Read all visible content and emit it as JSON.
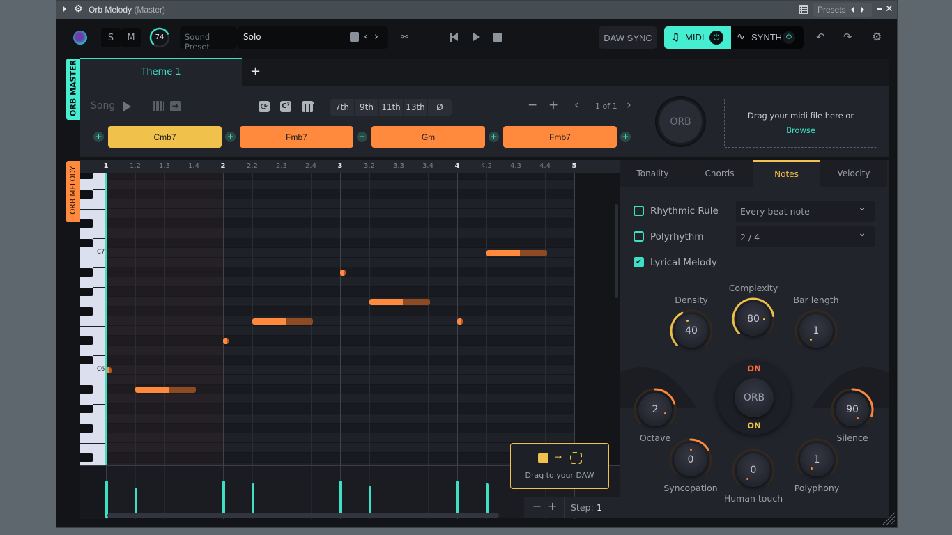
{
  "titlebar": {
    "app_name": "Orb Melody",
    "mode": "(Master)",
    "presets_label": "Presets"
  },
  "topbar": {
    "solo_label": "S",
    "mute_label": "M",
    "volume_value": "74",
    "volume_fraction": 0.74,
    "sound_preset_label": "Sound Preset",
    "sound_preset_value": "Solo",
    "daw_sync_label": "DAW SYNC",
    "midi_label": "MIDI",
    "synth_label": "SYNTH"
  },
  "side_tabs": {
    "master": "ORB MASTER",
    "melody": "ORB MELODY"
  },
  "theme_tabs": [
    {
      "label": "Theme 1",
      "active": true
    }
  ],
  "add_theme_label": "+",
  "song_controls": {
    "song_label": "Song",
    "extensions": [
      "7th",
      "9th",
      "11th",
      "13th",
      "Ø"
    ],
    "page_indicator": "1 of 1"
  },
  "chords": [
    {
      "label": "Cmb7",
      "color": "#f0c24b"
    },
    {
      "label": "Fmb7",
      "color": "#ff8a3d"
    },
    {
      "label": "Gm",
      "color": "#ff8a3d"
    },
    {
      "label": "Fmb7",
      "color": "#ff8a3d"
    }
  ],
  "orb_label": "ORB",
  "midi_drop": {
    "text": "Drag your midi file here or",
    "browse_label": "Browse"
  },
  "piano_roll": {
    "ruler": [
      "1",
      "1.2",
      "1.3",
      "1.4",
      "2",
      "2.2",
      "2.3",
      "2.4",
      "3",
      "3.2",
      "3.3",
      "3.4",
      "4",
      "4.2",
      "4.3",
      "4.4",
      "5"
    ],
    "key_labels": [
      "C7",
      "C6"
    ],
    "notes": [
      {
        "pitch": "C6",
        "start": 1.0,
        "length": 0.05
      },
      {
        "pitch": "A#5",
        "start": 1.25,
        "length": 0.52
      },
      {
        "pitch": "D#6",
        "start": 2.0,
        "length": 0.05
      },
      {
        "pitch": "F6",
        "start": 2.25,
        "length": 0.52
      },
      {
        "pitch": "A#6",
        "start": 3.0,
        "length": 0.05
      },
      {
        "pitch": "G6",
        "start": 3.25,
        "length": 0.52
      },
      {
        "pitch": "F6",
        "start": 4.0,
        "length": 0.05
      },
      {
        "pitch": "C7",
        "start": 4.25,
        "length": 0.52
      }
    ],
    "velocities": [
      {
        "pos": 1.0,
        "value": 1.0
      },
      {
        "pos": 1.25,
        "value": 0.81
      },
      {
        "pos": 2.0,
        "value": 1.0
      },
      {
        "pos": 2.25,
        "value": 0.92
      },
      {
        "pos": 3.0,
        "value": 1.0
      },
      {
        "pos": 3.25,
        "value": 0.85
      },
      {
        "pos": 4.0,
        "value": 1.0
      },
      {
        "pos": 4.25,
        "value": 0.92
      }
    ],
    "drag_to_daw_label": "Drag to your DAW",
    "step_label": "Step:",
    "step_value": "1"
  },
  "right_panel": {
    "tabs": [
      {
        "label": "Tonality",
        "active": false
      },
      {
        "label": "Chords",
        "active": false
      },
      {
        "label": "Notes",
        "active": true
      },
      {
        "label": "Velocity",
        "active": false
      }
    ],
    "options": [
      {
        "label": "Rhythmic Rule",
        "checked": false,
        "dropdown": "Every beat note"
      },
      {
        "label": "Polyrhythm",
        "checked": false,
        "dropdown": "2 / 4"
      },
      {
        "label": "Lyrical Melody",
        "checked": true
      }
    ],
    "knobs": {
      "density": {
        "label": "Density",
        "value": "40"
      },
      "complexity": {
        "label": "Complexity",
        "value": "80"
      },
      "bar_length": {
        "label": "Bar length",
        "value": "1"
      },
      "octave": {
        "label": "Octave",
        "value": "2"
      },
      "silence": {
        "label": "Silence",
        "value": "90"
      },
      "syncopation": {
        "label": "Syncopation",
        "value": "0"
      },
      "human_touch": {
        "label": "Human touch",
        "value": "0"
      },
      "polyphony": {
        "label": "Polyphony",
        "value": "1"
      }
    },
    "orb_center": {
      "label": "ORB",
      "top_state": "ON",
      "bottom_state": "ON"
    }
  },
  "colors": {
    "accent_teal": "#3ee0c4",
    "accent_orange": "#ff8a3d",
    "accent_yellow": "#f0c24b"
  }
}
